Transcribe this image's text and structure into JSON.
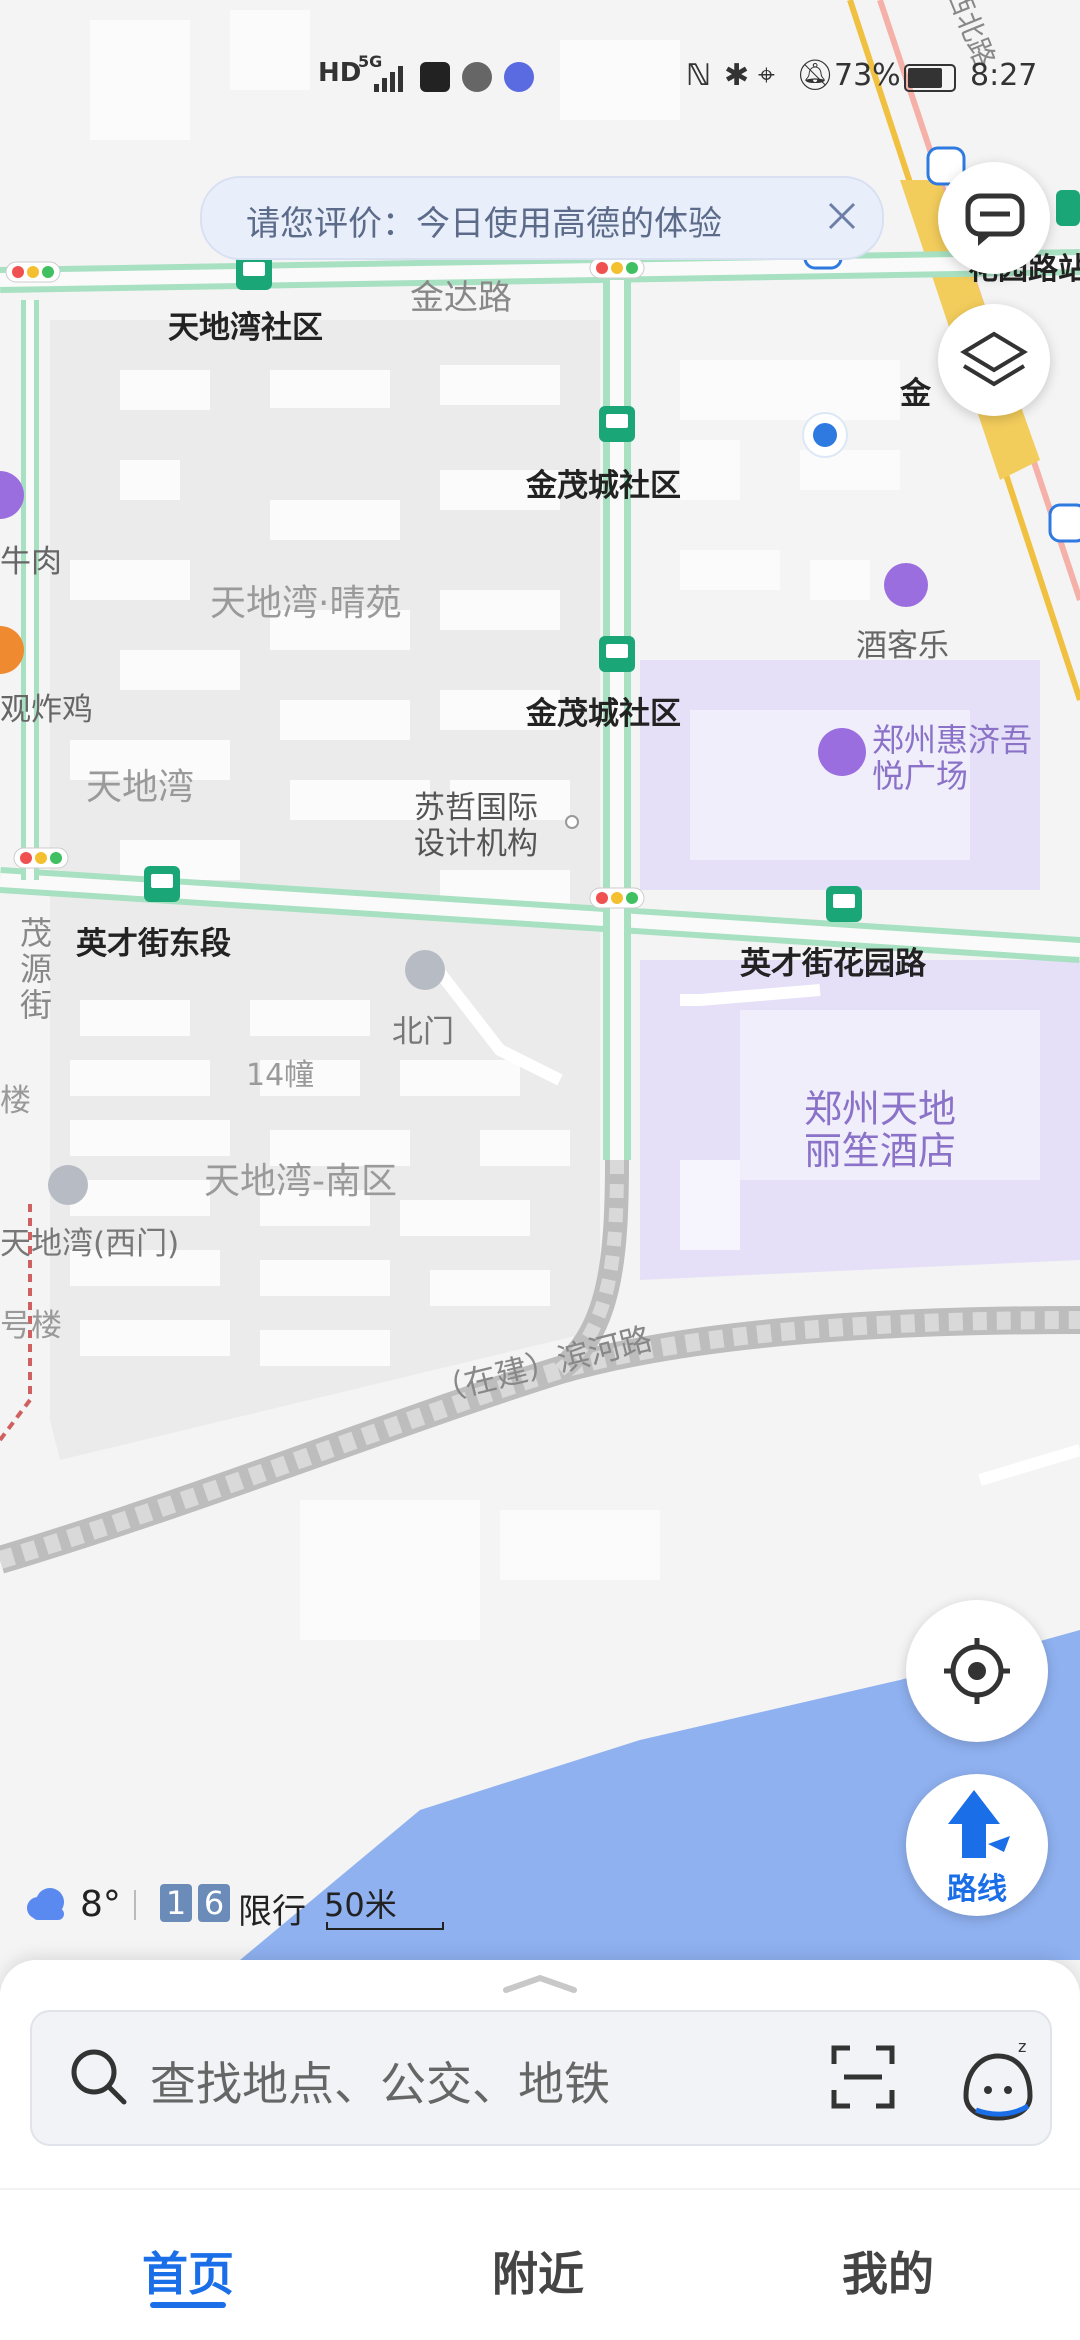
{
  "status_bar": {
    "network_left": "HD",
    "signal_label": "5G",
    "battery_percent": "73%",
    "time": "8:27"
  },
  "review_prompt": {
    "text": "请您评价：今日使用高德的体验"
  },
  "map": {
    "roads": [
      {
        "name": "金达路"
      },
      {
        "name": "（在建）滨河路"
      },
      {
        "name": "茂源街"
      }
    ],
    "bus_stops": [
      {
        "name": "天地湾社区"
      },
      {
        "name": "金茂城社区"
      },
      {
        "name": "金茂城社区"
      },
      {
        "name": "英才街东段"
      },
      {
        "name": "英才街花园路"
      }
    ],
    "areas": [
      {
        "name": "天地湾·晴苑"
      },
      {
        "name": "天地湾"
      },
      {
        "name": "天地湾-南区"
      },
      {
        "name": "14幢"
      }
    ],
    "pois": [
      {
        "name": "苏哲国际设计机构"
      },
      {
        "name": "北门"
      },
      {
        "name": "酒客乐"
      },
      {
        "name": "郑州惠济吾悦广场"
      },
      {
        "name": "郑州天地丽笙酒店"
      },
      {
        "name": "天地湾(西门)"
      }
    ],
    "edge_labels": [
      {
        "name": "花园路站"
      },
      {
        "name": "金"
      },
      {
        "name": "牛肉"
      },
      {
        "name": "观炸鸡"
      },
      {
        "name": "楼"
      },
      {
        "name": "号楼"
      },
      {
        "name": "西北路"
      }
    ],
    "colors": {
      "water": "#8fb1f0",
      "mall": "#e5e0f7",
      "main_road": "#a8e0c2",
      "metro_line": "#f0c040",
      "bus_stop": "#1aa676"
    }
  },
  "weather": {
    "temperature": "8°",
    "restriction_digits": [
      "1",
      "6"
    ],
    "restriction_label": "限行",
    "scale": "50米"
  },
  "buttons": {
    "route_label": "路线"
  },
  "search": {
    "placeholder": "查找地点、公交、地铁"
  },
  "tabs": [
    {
      "label": "首页",
      "active": true
    },
    {
      "label": "附近",
      "active": false
    },
    {
      "label": "我的",
      "active": false
    }
  ]
}
